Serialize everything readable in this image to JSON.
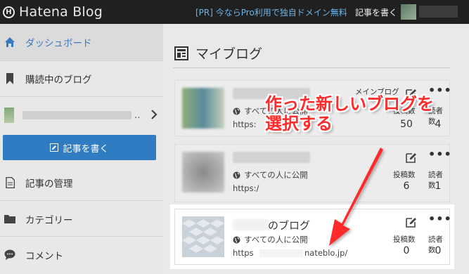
{
  "topbar": {
    "logo_text": "Hatena Blog",
    "logo_mark": "H",
    "pr_link": "[PR] 今ならPro利用で独自ドメイン無料",
    "write_link": "記事を書く"
  },
  "sidebar": {
    "dashboard_label": "ダッシュボード",
    "reading_label": "購読中のブログ",
    "blog_selector_dots": "..",
    "write_button_label": "記事を書く",
    "manage_label": "記事の管理",
    "category_label": "カテゴリー",
    "comment_label": "コメント"
  },
  "main": {
    "title": "マイブログ",
    "cards": [
      {
        "main_label": "メインブログ",
        "public_label": "すべての人に公開",
        "url_prefix": "https:",
        "posts_label": "投稿数",
        "readers_label": "読者数",
        "posts": "50",
        "readers": "4"
      },
      {
        "public_label": "すべての人に公開",
        "url_prefix": "https:/",
        "posts_label": "投稿数",
        "readers_label": "読者数",
        "posts": "6",
        "readers": "1"
      },
      {
        "name_suffix": "のブログ",
        "public_label": "すべての人に公開",
        "url_prefix": "https",
        "url_suffix": "nateblo.jp/",
        "posts_label": "投稿数",
        "readers_label": "読者数",
        "posts": "0",
        "readers": "0"
      }
    ]
  },
  "annotation": {
    "line1": "作った新しいブログを",
    "line2": "選択する",
    "color": "#ff2a2a"
  },
  "colors": {
    "accent": "#2f7cc3",
    "topbar_bg": "#202020",
    "pr_link": "#6ab4e8"
  },
  "icons": {
    "home": "home-icon",
    "bookmark": "bookmark-icon",
    "chevron": "chevron-right-icon",
    "pencil": "pencil-icon",
    "document": "document-icon",
    "folder": "folder-icon",
    "comment": "comment-bubble-icon",
    "blog_list": "blog-list-icon",
    "globe": "globe-icon",
    "more": "more-dots-icon"
  }
}
